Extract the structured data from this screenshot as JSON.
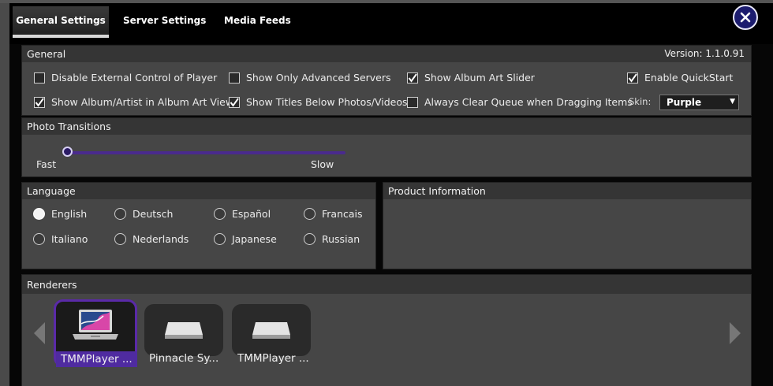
{
  "tabs": [
    {
      "label": "General Settings",
      "active": true
    },
    {
      "label": "Server Settings",
      "active": false
    },
    {
      "label": "Media Feeds",
      "active": false
    }
  ],
  "general": {
    "title": "General",
    "version": "Version: 1.1.0.91",
    "options": [
      {
        "label": "Disable External Control of Player",
        "checked": false
      },
      {
        "label": "Show Only Advanced Servers",
        "checked": false
      },
      {
        "label": "Show Album Art Slider",
        "checked": true
      },
      {
        "label": "Enable QuickStart",
        "checked": true
      },
      {
        "label": "Show Album/Artist in Album Art View",
        "checked": true
      },
      {
        "label": "Show Titles Below Photos/Videos",
        "checked": true
      },
      {
        "label": "Always Clear Queue when Dragging Items",
        "checked": false
      }
    ],
    "skin_label": "Skin:",
    "skin_value": "Purple"
  },
  "photo_transitions": {
    "title": "Photo Transitions",
    "min_label": "Fast",
    "max_label": "Slow",
    "value": 0
  },
  "language": {
    "title": "Language",
    "options": [
      "English",
      "Deutsch",
      "Español",
      "Francais",
      "Italiano",
      "Nederlands",
      "Japanese",
      "Russian"
    ],
    "selected": "English"
  },
  "product_info": {
    "title": "Product Information"
  },
  "renderers": {
    "title": "Renderers",
    "items": [
      {
        "name": "TMMPlayer ...",
        "selected": true,
        "icon": "laptop-icon"
      },
      {
        "name": "Pinnacle Sy...",
        "selected": false,
        "icon": "device-icon"
      },
      {
        "name": "TMMPlayer ...",
        "selected": false,
        "icon": "device-icon"
      }
    ]
  },
  "colors": {
    "accent": "#5a2aa8",
    "panel": "#464646",
    "header": "#353535",
    "close": "#1c1c6e"
  }
}
